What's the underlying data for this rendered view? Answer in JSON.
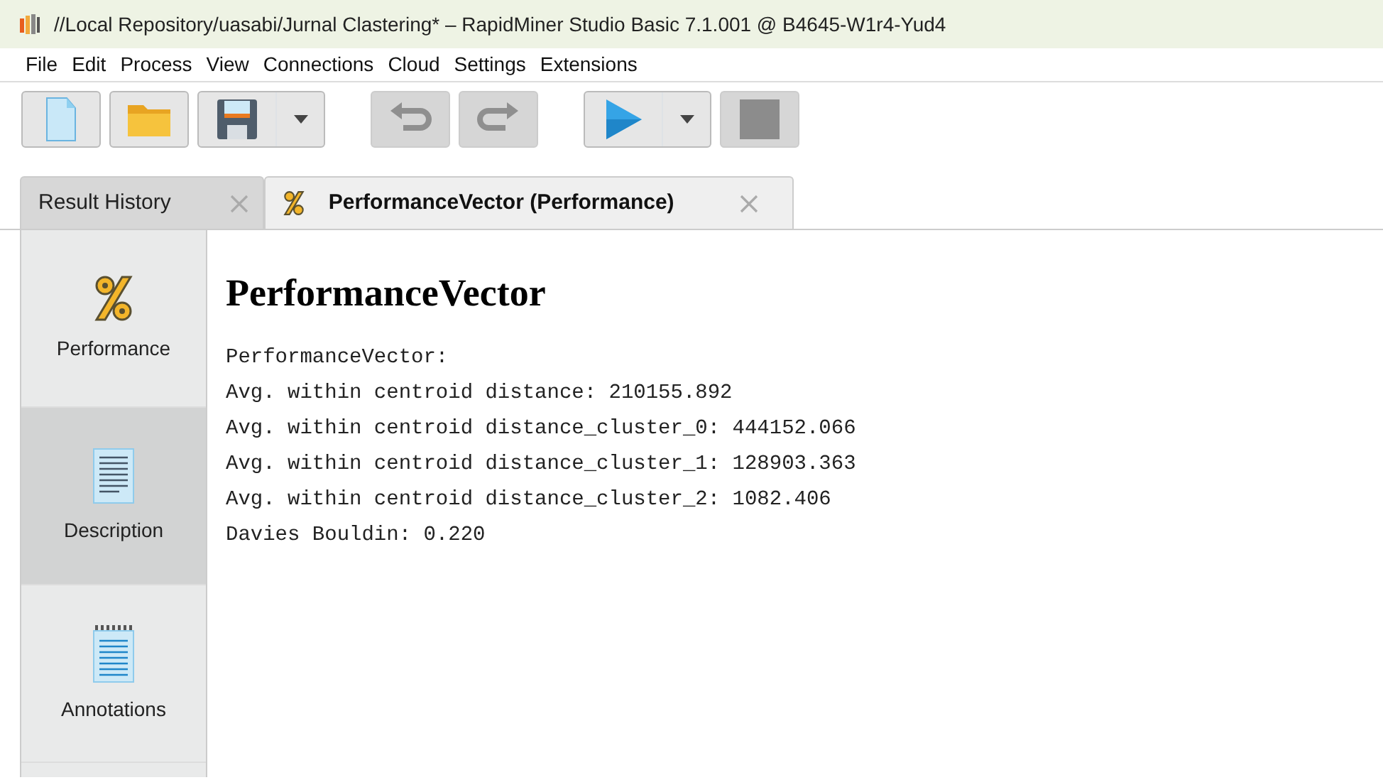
{
  "window": {
    "title": "//Local Repository/uasabi/Jurnal Clastering* – RapidMiner Studio Basic 7.1.001 @ B4645-W1r4-Yud4"
  },
  "menu": [
    "File",
    "Edit",
    "Process",
    "View",
    "Connections",
    "Cloud",
    "Settings",
    "Extensions"
  ],
  "toolbar": [
    {
      "kind": "new",
      "disabled": false,
      "dropdown": false
    },
    {
      "kind": "open",
      "disabled": false,
      "dropdown": false
    },
    {
      "kind": "save",
      "disabled": false,
      "dropdown": true
    },
    {
      "kind": "undo",
      "disabled": true,
      "dropdown": false
    },
    {
      "kind": "redo",
      "disabled": true,
      "dropdown": false
    },
    {
      "kind": "run",
      "disabled": false,
      "dropdown": true
    },
    {
      "kind": "stop",
      "disabled": true,
      "dropdown": false
    }
  ],
  "tabs": [
    {
      "label": "Result History",
      "selected": false,
      "icon": false
    },
    {
      "label": "PerformanceVector (Performance)",
      "selected": true,
      "icon": true
    }
  ],
  "sidebar": {
    "items": [
      {
        "label": "Performance",
        "kind": "percent",
        "selected": false
      },
      {
        "label": "Description",
        "kind": "document",
        "selected": true
      },
      {
        "label": "Annotations",
        "kind": "notepad",
        "selected": false
      }
    ]
  },
  "content": {
    "heading": "PerformanceVector",
    "lines": [
      "PerformanceVector:",
      "Avg. within centroid distance: 210155.892",
      "Avg. within centroid distance_cluster_0: 444152.066",
      "Avg. within centroid distance_cluster_1: 128903.363",
      "Avg. within centroid distance_cluster_2: 1082.406",
      "Davies Bouldin: 0.220"
    ]
  }
}
